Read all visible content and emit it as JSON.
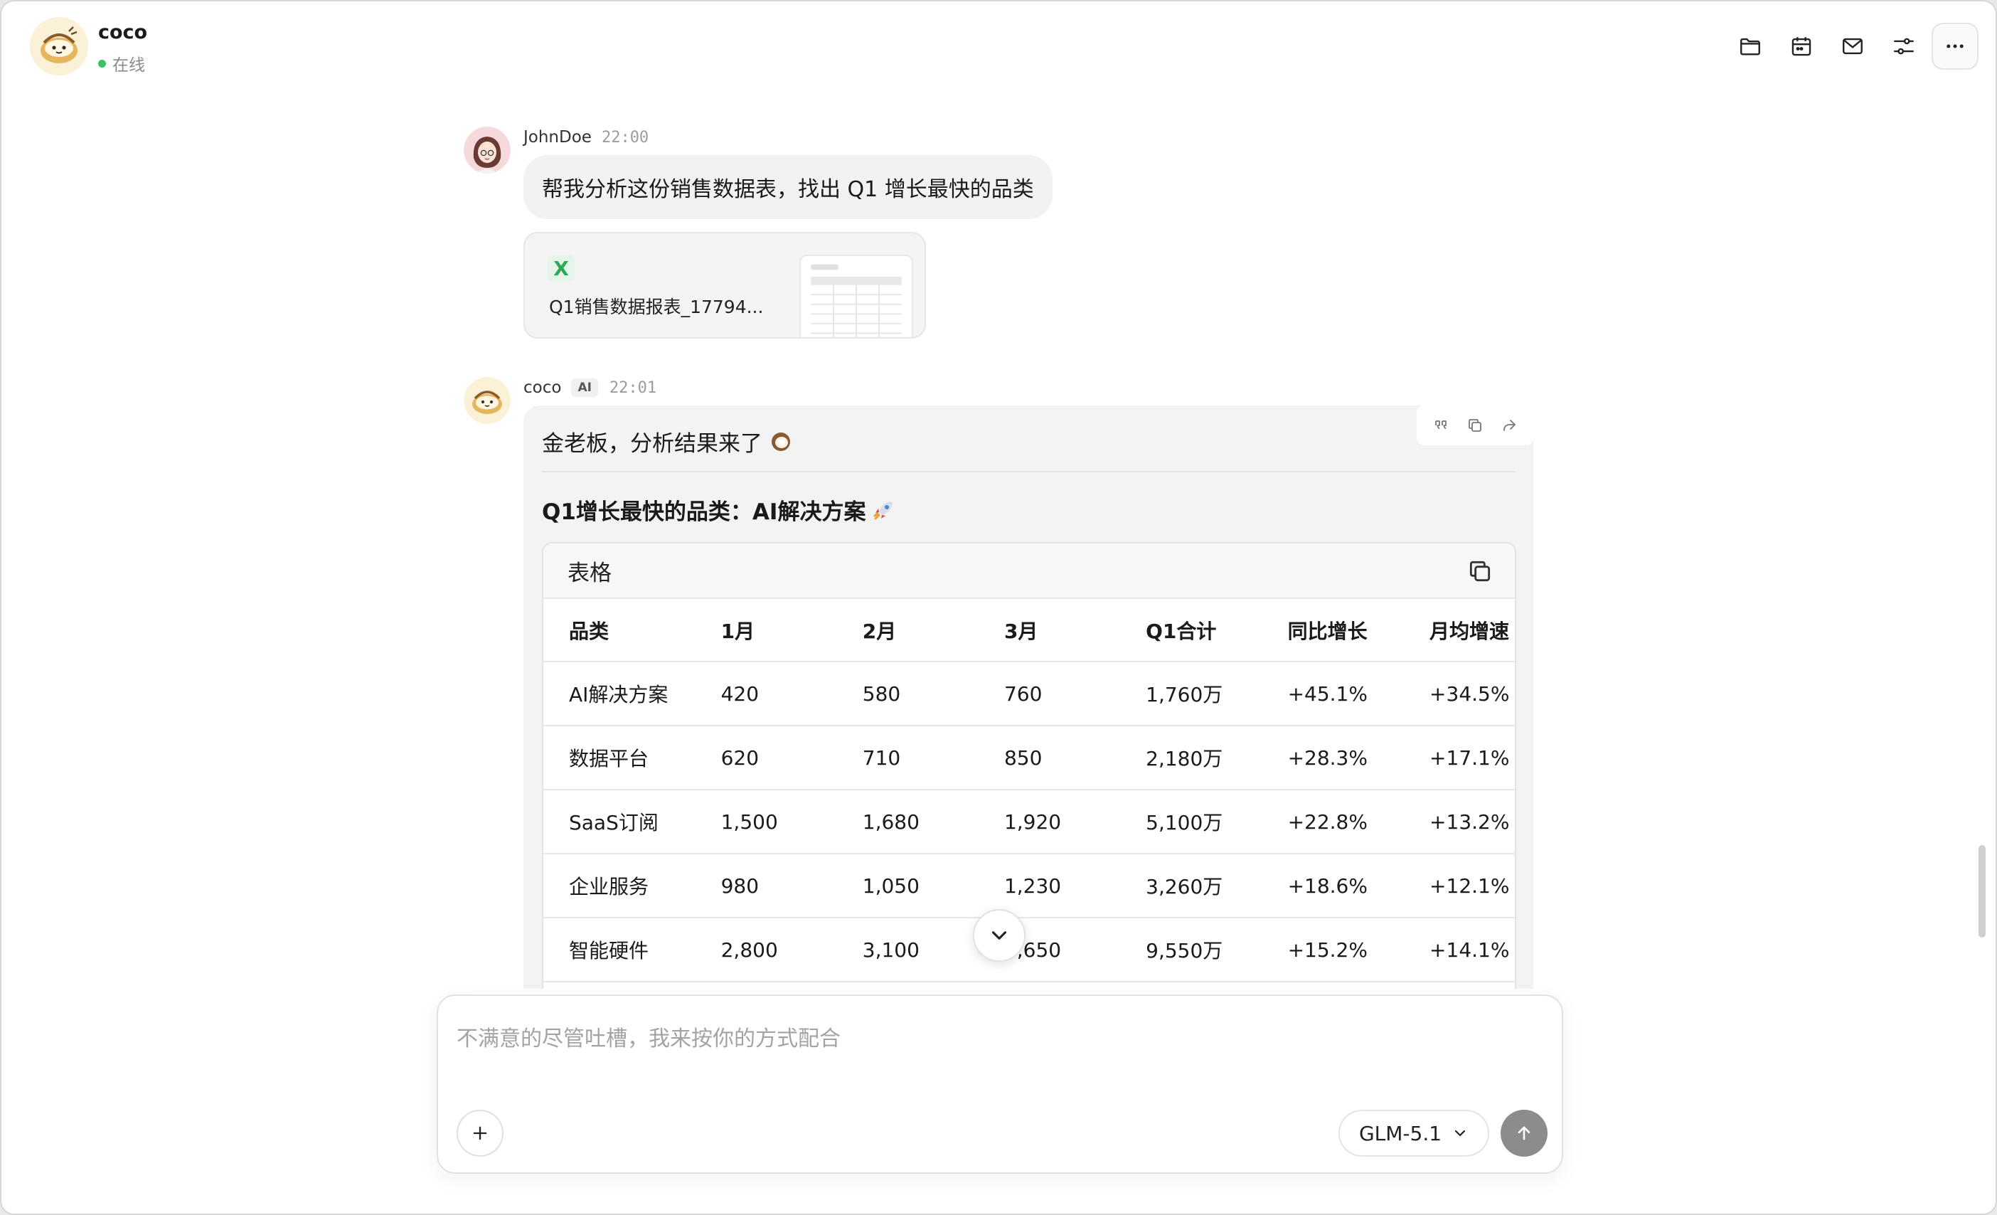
{
  "header": {
    "bot_name": "coco",
    "status": "在线",
    "icons": [
      "folder-icon",
      "calendar-icon",
      "mail-icon",
      "filter-icon",
      "more-icon"
    ]
  },
  "messages": {
    "user": {
      "name": "JohnDoe",
      "time": "22:00",
      "text": "帮我分析这份销售数据表，找出 Q1 增长最快的品类",
      "attachment": {
        "badge": "X",
        "file_name": "Q1销售数据报表_17794..."
      }
    },
    "ai": {
      "name": "coco",
      "badge": "AI",
      "time": "22:01",
      "greeting": "金老板，分析结果来了",
      "heading": "Q1增长最快的品类：AI解决方案",
      "table": {
        "title": "表格",
        "headers": [
          "品类",
          "1月",
          "2月",
          "3月",
          "Q1合计",
          "同比增长",
          "月均增速"
        ],
        "rows": [
          [
            "AI解决方案",
            "420",
            "580",
            "760",
            "1,760万",
            "+45.1%",
            "+34.5%"
          ],
          [
            "数据平台",
            "620",
            "710",
            "850",
            "2,180万",
            "+28.3%",
            "+17.1%"
          ],
          [
            "SaaS订阅",
            "1,500",
            "1,680",
            "1,920",
            "5,100万",
            "+22.8%",
            "+13.2%"
          ],
          [
            "企业服务",
            "980",
            "1,050",
            "1,230",
            "3,260万",
            "+18.6%",
            "+12.1%"
          ],
          [
            "智能硬件",
            "2,800",
            "3,100",
            "3,650",
            "9,550万",
            "+15.2%",
            "+14.1%"
          ]
        ]
      }
    }
  },
  "composer": {
    "placeholder": "不满意的尽管吐槽，我来按你的方式配合",
    "model": "GLM-5.1"
  },
  "colors": {
    "status_online": "#36c26a",
    "excel_green": "#2fa85a",
    "send_button": "#8c8c8c"
  }
}
